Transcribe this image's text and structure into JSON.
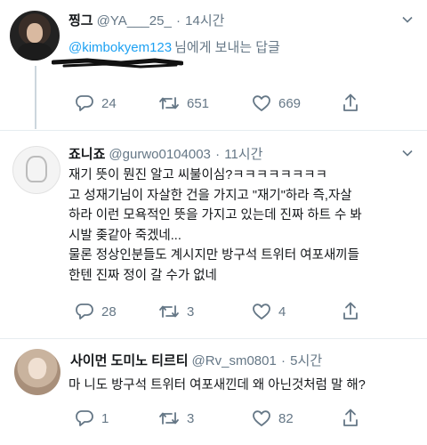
{
  "tweets": [
    {
      "name": "찡그",
      "handle": "@YA___25_",
      "separator": "·",
      "time": "14시간",
      "reply_to": {
        "mention": "@kimbokyem123",
        "suffix": "님에게 보내는 답글"
      },
      "body": [],
      "stats": {
        "replies": "24",
        "retweets": "651",
        "likes": "669"
      }
    },
    {
      "name": "죠니죠",
      "handle": "@gurwo0104003",
      "separator": "·",
      "time": "11시간",
      "body": [
        "재기 뜻이 뭔진 알고 씨불이심?ㅋㅋㅋㅋㅋㅋㅋㅋ",
        "고 성재기님이 자살한 건을 가지고 \"재기\"하라 즉,자살",
        "하라 이런 모욕적인 뜻을 가지고 있는데 진짜 하트 수 봐",
        "시발 좆같아 죽겠네...",
        "물론 정상인분들도 계시지만 방구석 트위터 여포새끼들",
        "한텐 진짜 정이 갈 수가 없네"
      ],
      "stats": {
        "replies": "28",
        "retweets": "3",
        "likes": "4"
      }
    },
    {
      "name": "사이먼 도미노 티르티",
      "handle": "@Rv_sm0801",
      "separator": "·",
      "time": "5시간",
      "body": [
        "마 니도 방구석 트위터 여포새낀데 왜 아닌것처럼 말 해?"
      ],
      "stats": {
        "replies": "1",
        "retweets": "3",
        "likes": "82"
      }
    }
  ],
  "colors": {
    "text": "#14171a",
    "secondary": "#657786",
    "link": "#1da1f2",
    "divider": "#e6ecf0",
    "thread_line": "#ccd6dd"
  },
  "icons": [
    "reply-icon",
    "retweet-icon",
    "like-icon",
    "share-icon",
    "chevron-down-icon"
  ]
}
